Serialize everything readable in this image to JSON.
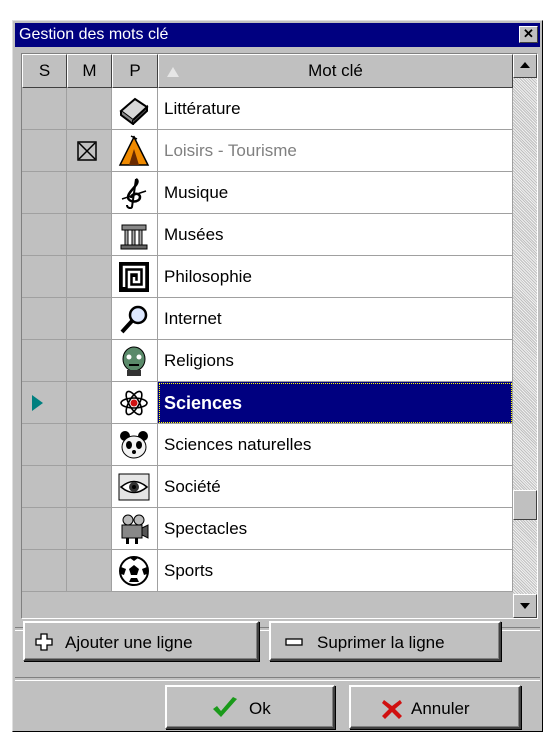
{
  "window": {
    "title": "Gestion des mots clé"
  },
  "grid": {
    "headers": {
      "s": "S",
      "m": "M",
      "p": "P",
      "keyword": "Mot clé"
    },
    "rows": [
      {
        "keyword": "Littérature",
        "icon": "book-icon",
        "marked": false,
        "dim": false,
        "selected": false
      },
      {
        "keyword": "Loisirs - Tourisme",
        "icon": "tent-icon",
        "marked": true,
        "dim": true,
        "selected": false
      },
      {
        "keyword": "Musique",
        "icon": "treble-clef-icon",
        "marked": false,
        "dim": false,
        "selected": false
      },
      {
        "keyword": "Musées",
        "icon": "temple-icon",
        "marked": false,
        "dim": false,
        "selected": false
      },
      {
        "keyword": "Philosophie",
        "icon": "greek-key-icon",
        "marked": false,
        "dim": false,
        "selected": false
      },
      {
        "keyword": "Internet",
        "icon": "magnifier-icon",
        "marked": false,
        "dim": false,
        "selected": false
      },
      {
        "keyword": "Religions",
        "icon": "statue-head-icon",
        "marked": false,
        "dim": false,
        "selected": false
      },
      {
        "keyword": "Sciences",
        "icon": "atom-icon",
        "marked": false,
        "dim": false,
        "selected": true
      },
      {
        "keyword": "Sciences naturelles",
        "icon": "panda-icon",
        "marked": false,
        "dim": false,
        "selected": false
      },
      {
        "keyword": "Société",
        "icon": "eye-icon",
        "marked": false,
        "dim": false,
        "selected": false
      },
      {
        "keyword": "Spectacles",
        "icon": "movie-camera-icon",
        "marked": false,
        "dim": false,
        "selected": false
      },
      {
        "keyword": "Sports",
        "icon": "soccer-ball-icon",
        "marked": false,
        "dim": false,
        "selected": false
      }
    ]
  },
  "actions": {
    "add_line": "Ajouter une ligne",
    "delete_line": "Suprimer la ligne",
    "ok": "Ok",
    "cancel": "Annuler"
  },
  "colors": {
    "titlebar": "#000080",
    "face": "#c0c0c0",
    "selection": "#000080",
    "row_pointer": "#008080",
    "ok_check": "#1a9a1a",
    "cancel_x": "#d01010"
  }
}
